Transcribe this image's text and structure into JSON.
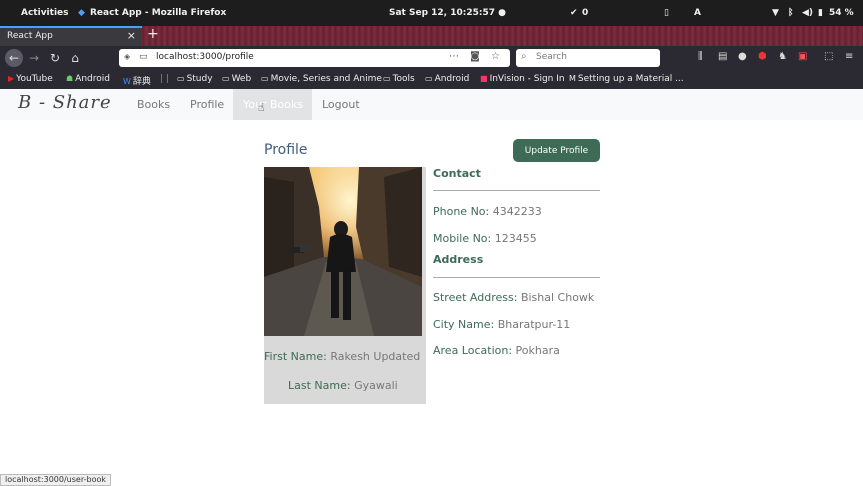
{
  "system": {
    "activities": "Activities",
    "window_title": "React App - Mozilla Firefox",
    "clock": "Sat Sep 12, 10:25:57 ●",
    "check_count": "0",
    "keyboard_label": "A",
    "battery": "54 %"
  },
  "browser": {
    "tab_title": "React App",
    "url": "localhost:3000/profile",
    "search_placeholder": "Search",
    "bookmarks": [
      {
        "icon": "youtube-icon",
        "label": "YouTube"
      },
      {
        "icon": "android-icon",
        "label": "Android"
      },
      {
        "icon": "w-icon",
        "label": "辞典"
      },
      {
        "icon": "folder-icon",
        "label": "Study"
      },
      {
        "icon": "folder-icon",
        "label": "Web"
      },
      {
        "icon": "folder-icon",
        "label": "Movie, Series and Anime"
      },
      {
        "icon": "folder-icon",
        "label": "Tools"
      },
      {
        "icon": "folder-icon",
        "label": "Android"
      },
      {
        "icon": "invision-icon",
        "label": "InVision - Sign In"
      },
      {
        "icon": "medium-icon",
        "label": "Setting up a Material ..."
      }
    ],
    "status_url": "localhost:3000/user-book"
  },
  "app": {
    "brand": "B - Share",
    "nav": [
      "Books",
      "Profile",
      "Your Books",
      "Logout"
    ],
    "page_title": "Profile",
    "update_button": "Update Profile",
    "profile": {
      "first_name_label": "First Name:",
      "first_name": "Rakesh Updated",
      "last_name_label": "Last Name:",
      "last_name": "Gyawali"
    },
    "contact": {
      "heading": "Contact",
      "phone_label": "Phone No:",
      "phone": "4342233",
      "mobile_label": "Mobile No:",
      "mobile": "123455"
    },
    "address": {
      "heading": "Address",
      "street_label": "Street Address:",
      "street": "Bishal Chowk",
      "city_label": "City Name:",
      "city": "Bharatpur-11",
      "area_label": "Area Location:",
      "area": "Pokhara"
    }
  },
  "colors": {
    "accent_green": "#3d6b55",
    "title_blue": "#3e5e7e",
    "navbar_bg": "#f8f9fa"
  }
}
